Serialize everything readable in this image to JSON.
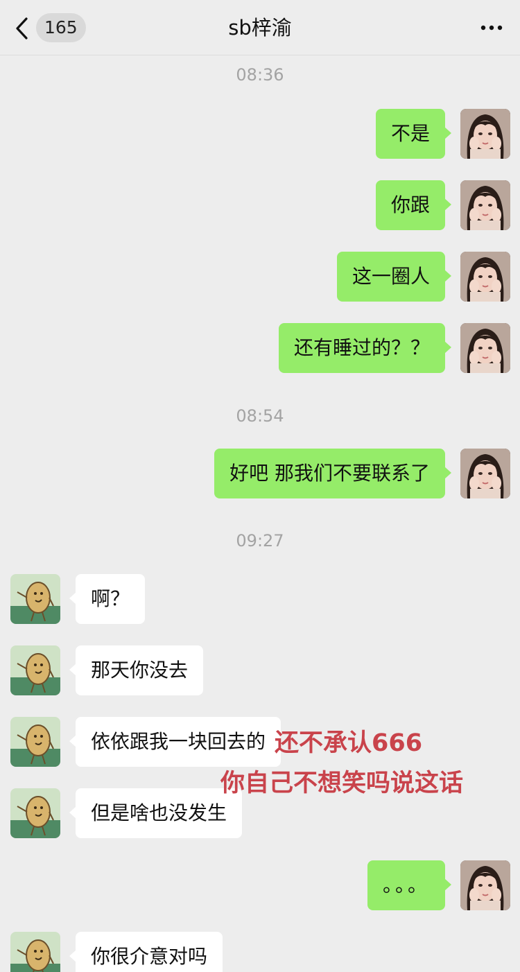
{
  "header": {
    "unread_count": "165",
    "title": "sb梓渝"
  },
  "timestamps": [
    "08:36",
    "08:54",
    "09:27"
  ],
  "messages": [
    {
      "side": "right",
      "text": "不是"
    },
    {
      "side": "right",
      "text": "你跟"
    },
    {
      "side": "right",
      "text": "这一圈人"
    },
    {
      "side": "right",
      "text": "还有睡过的？？"
    },
    {
      "side": "right",
      "text": "好吧  那我们不要联系了"
    },
    {
      "side": "left",
      "text": "啊？"
    },
    {
      "side": "left",
      "text": "那天你没去"
    },
    {
      "side": "left",
      "text": "依依跟我一块回去的"
    },
    {
      "side": "left",
      "text": "但是啥也没发生"
    },
    {
      "side": "right",
      "text": "。。。"
    },
    {
      "side": "left",
      "text": "你很介意对吗"
    }
  ],
  "overlay_caption": {
    "line1": "还不承认666",
    "line2": "你自己不想笑吗说这话",
    "color": "#c9434b"
  },
  "colors": {
    "background": "#ededed",
    "right_bubble": "#95ec69",
    "left_bubble": "#ffffff",
    "timestamp": "#a3a3a3"
  },
  "icons": {
    "back": "chevron-left-icon",
    "more": "more-dots-icon",
    "self_avatar": "girl-portrait-avatar",
    "contact_avatar": "potato-cartoon-avatar"
  }
}
